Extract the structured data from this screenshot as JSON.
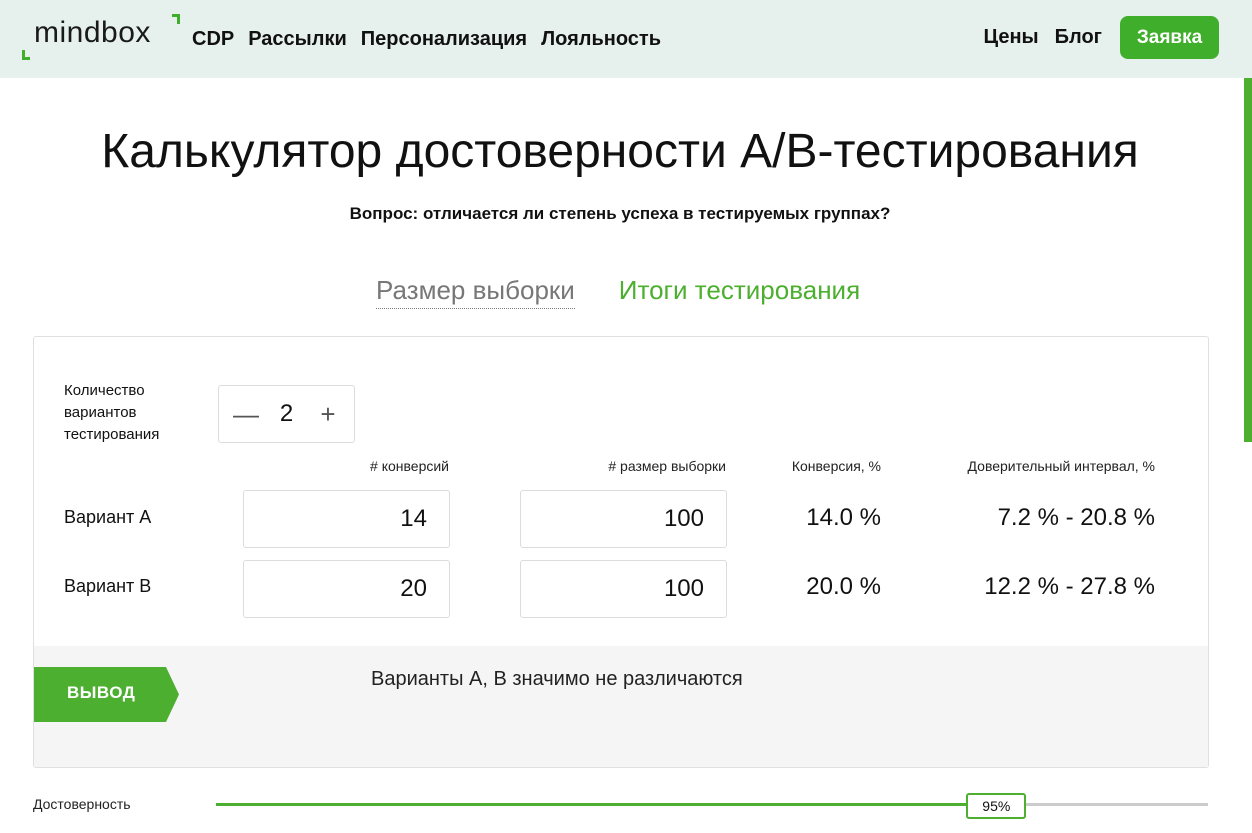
{
  "header": {
    "logo": "mindbox",
    "nav": [
      "CDP",
      "Рассылки",
      "Персонализация",
      "Лояльность"
    ],
    "nav_right": [
      "Цены",
      "Блог"
    ],
    "cta_label": "Заявка"
  },
  "title": "Калькулятор достоверности A/B-тестирования",
  "subtitle": "Вопрос: отличается ли степень успеха в тестируемых группах?",
  "tabs": {
    "size": "Размер выборки",
    "results": "Итоги тестирования"
  },
  "variants_count": {
    "label": "Количество вариантов тестирования",
    "minus": "—",
    "value": "2",
    "plus": "+"
  },
  "columns": {
    "conversions": "# конверсий",
    "sample_size": "# размер выборки",
    "conversion_rate": "Конверсия, %",
    "confidence_interval": "Доверительный интервал, %"
  },
  "rows": [
    {
      "label": "Вариант A",
      "conversions": "14",
      "sample": "100",
      "rate": "14.0 %",
      "interval": "7.2 % - 20.8 %"
    },
    {
      "label": "Вариант B",
      "conversions": "20",
      "sample": "100",
      "rate": "20.0 %",
      "interval": "12.2 % - 27.8 %"
    }
  ],
  "conclusion": {
    "tag": "ВЫВОД",
    "text": "Варианты A, B значимо не различаются"
  },
  "confidence": {
    "label": "Достоверность",
    "value_label": "95%",
    "value": 0.95
  },
  "colors": {
    "accent": "#3fae2a",
    "header_bg": "#e6f0ed",
    "panel_bg": "#f5f5f5"
  }
}
